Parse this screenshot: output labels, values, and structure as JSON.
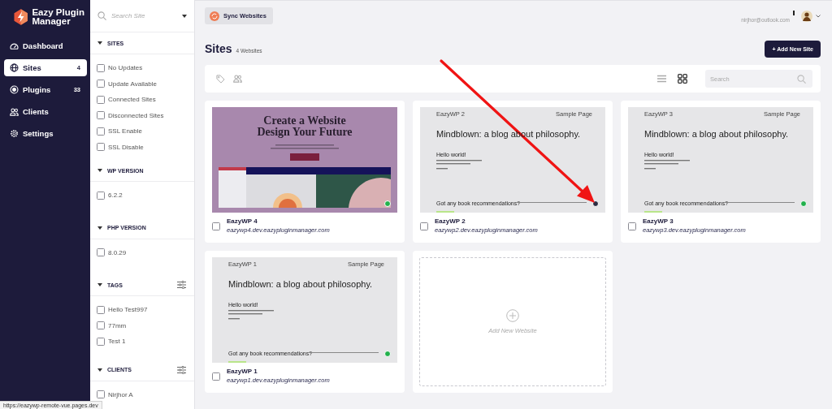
{
  "brand": {
    "name": "Eazy Plugin Manager"
  },
  "nav": [
    {
      "label": "Dashboard",
      "selected": false
    },
    {
      "label": "Sites",
      "count": "4",
      "selected": true
    },
    {
      "label": "Plugins",
      "count": "33",
      "selected": false
    },
    {
      "label": "Clients",
      "selected": false
    },
    {
      "label": "Settings",
      "selected": false
    }
  ],
  "filters": {
    "search_placeholder": "Search Site",
    "groups": [
      {
        "title": "SITES",
        "has_settings": false,
        "options": [
          {
            "label": "No Updates",
            "checked": false
          },
          {
            "label": "Update Available",
            "checked": false
          },
          {
            "label": "Connected Sites",
            "checked": false
          },
          {
            "label": "Disconnected Sites",
            "checked": false
          },
          {
            "label": "SSL Enable",
            "checked": false
          },
          {
            "label": "SSL Disable",
            "checked": false
          }
        ]
      },
      {
        "title": "WP VERSION",
        "has_settings": false,
        "options": [
          {
            "label": "6.2.2",
            "checked": false
          }
        ]
      },
      {
        "title": "PHP VERSION",
        "has_settings": false,
        "options": [
          {
            "label": "8.0.29",
            "checked": false
          }
        ]
      },
      {
        "title": "TAGS",
        "has_settings": true,
        "options": [
          {
            "label": "Hello Test997",
            "checked": false
          },
          {
            "label": "77mm",
            "checked": false
          },
          {
            "label": "Test 1",
            "checked": false
          }
        ]
      },
      {
        "title": "CLIENTS",
        "has_settings": true,
        "options": [
          {
            "label": "Nirjhor A",
            "checked": false
          }
        ]
      }
    ]
  },
  "topbar": {
    "sync_button": "Sync Websites",
    "user_email": "nirjhor@outlook.com"
  },
  "page": {
    "title": "Sites",
    "count": "4 Websites",
    "add_button": "+ Add New Site"
  },
  "toolbar": {
    "views": [
      {
        "selected": false
      },
      {
        "selected": true
      }
    ],
    "search_placeholder": "Search"
  },
  "sites": [
    {
      "name": "EazyWP 4",
      "url": "eazywp4.dev.eazypluginmanager.com",
      "checked": false,
      "color": "#22b14c",
      "preview": {
        "kind": "landing",
        "headline": [
          "Create a Website",
          "Design Your Future"
        ]
      }
    },
    {
      "name": "EazyWP 2",
      "url": "eazywp2.dev.eazypluginmanager.com",
      "checked": false,
      "color": "#2b2d42",
      "preview": {
        "kind": "blog",
        "site_label": "EazyWP 2",
        "menu_link": "Sample Page",
        "headline": "Mindblown: a blog about philosophy.",
        "post_title": "Hello world!",
        "question": "Got any book recommendations?"
      }
    },
    {
      "name": "EazyWP 3",
      "url": "eazywp3.dev.eazypluginmanager.com",
      "checked": false,
      "color": "#22b14c",
      "preview": {
        "kind": "blog",
        "site_label": "EazyWP 3",
        "menu_link": "Sample Page",
        "headline": "Mindblown: a blog about philosophy.",
        "post_title": "Hello world!",
        "question": "Got any book recommendations?"
      }
    },
    {
      "name": "EazyWP 1",
      "url": "eazywp1.dev.eazypluginmanager.com",
      "checked": false,
      "color": "#22b14c",
      "preview": {
        "kind": "blog",
        "site_label": "EazyWP 1",
        "menu_link": "Sample Page",
        "headline": "Mindblown: a blog about philosophy.",
        "post_title": "Hello world!",
        "question": "Got any book recommendations?"
      }
    }
  ],
  "add_card": {
    "label": "Add New Website"
  },
  "annotation": {
    "kind": "arrow"
  },
  "status_url": "https://eazywp-remote-vue.pages.dev"
}
